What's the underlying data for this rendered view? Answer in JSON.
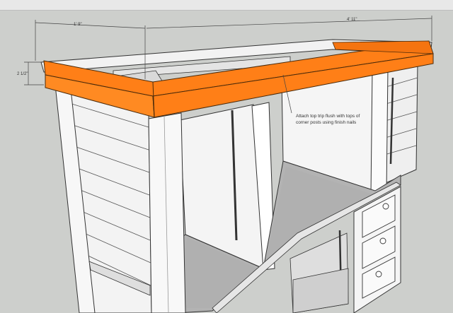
{
  "app": {
    "tool": "3D modeling viewport"
  },
  "colors": {
    "background": "#cdcfcc",
    "trim": "#ff7f17",
    "trim_shadow": "#c45e00",
    "panel": "#f4f4f4",
    "panel_shade": "#e1e1e1",
    "floor": "#b2b2b2",
    "edge": "#333333"
  },
  "dimensions": {
    "top_left_width": "1' 9\"",
    "top_total_length": "4' 11\"",
    "trim_height": "2 1/2\""
  },
  "annotation": {
    "line1": "Attach top trip flush with tops of",
    "line2": "corner posts using finish nails"
  },
  "drawers": {
    "knob_count": 3
  }
}
